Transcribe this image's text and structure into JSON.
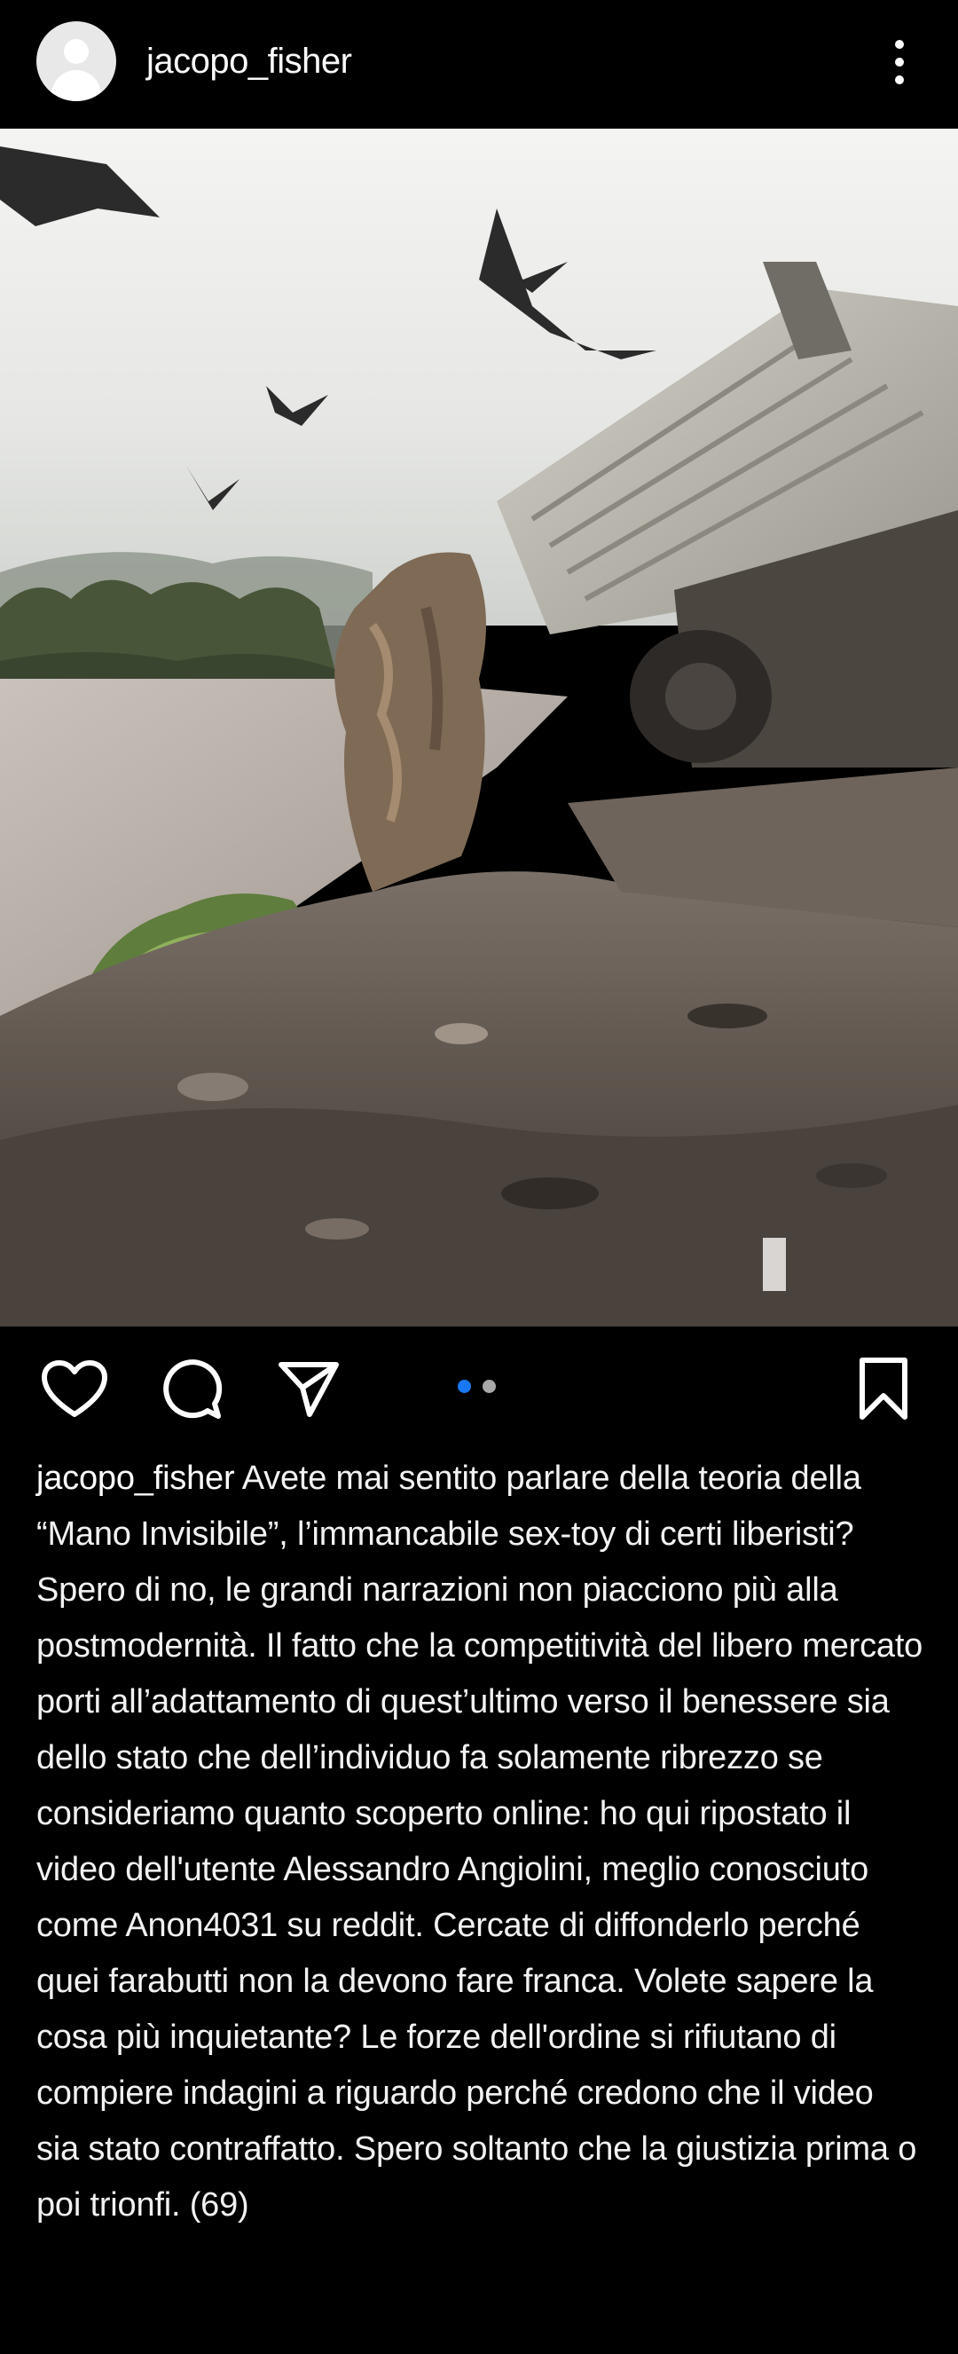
{
  "post": {
    "username": "jacopo_fisher",
    "more_icon": "more-vertical-icon"
  },
  "media": {
    "description_colors": {
      "sky": "#e9e9e6",
      "water": "#b9b3ad",
      "trees": "#4e5a3e",
      "truck": "#b8b6ac",
      "dirt": "#5c544c"
    },
    "carousel": {
      "count": 2,
      "active_index": 0,
      "active_color": "#1877f2",
      "inactive_color": "#a8a8a8"
    }
  },
  "actions": {
    "like_icon": "heart-icon",
    "comment_icon": "comment-icon",
    "share_icon": "send-icon",
    "save_icon": "bookmark-icon"
  },
  "caption": {
    "username": "jacopo_fisher",
    "text": "Avete mai sentito parlare della teoria della “Mano Invisibile”, l’immancabile sex-toy di certi liberisti? Spero di no, le grandi narrazioni non piacciono più alla postmodernità. Il fatto che la competitività del libero mercato porti all’adattamento di quest’ultimo verso il benessere sia dello stato che dell’individuo fa solamente ribrezzo se consideriamo quanto scoperto online: ho qui ripostato il video dell'utente Alessandro Angiolini, meglio conosciuto come Anon4031 su reddit. Cercate di diffonderlo perché quei farabutti non la devono fare franca. Volete sapere la cosa più inquietante? Le forze dell'ordine si rifiutano di compiere indagini a riguardo perché credono che il video sia stato contraffatto. Spero soltanto che la giustizia prima o poi trionfi. (69)"
  }
}
